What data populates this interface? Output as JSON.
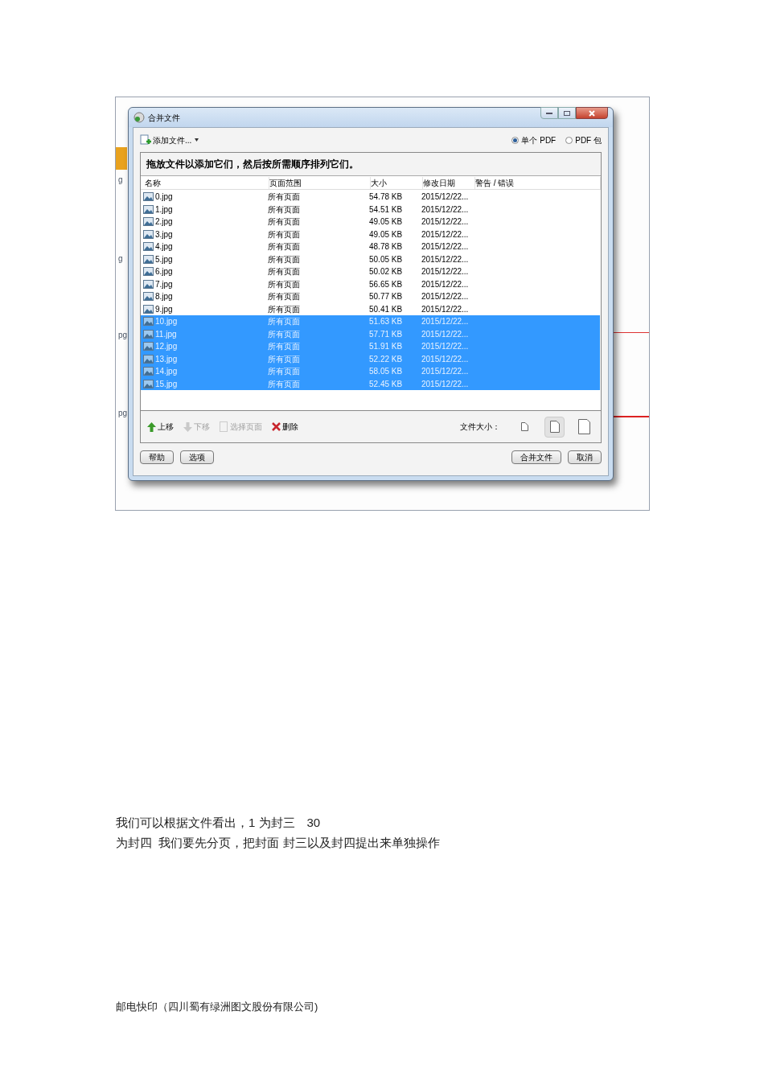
{
  "background_app": {
    "fragments": [
      "g",
      "g",
      "pg",
      "pg"
    ]
  },
  "dialog": {
    "title": "合并文件",
    "add_button": "添加文件...",
    "output_options": [
      {
        "label": "单个 PDF",
        "selected": true
      },
      {
        "label": "PDF 包",
        "selected": false
      }
    ],
    "instruction": "拖放文件以添加它们，然后按所需顺序排列它们。",
    "table": {
      "columns": [
        "名称",
        "页面范围",
        "大小",
        "修改日期",
        "警告 / 错误"
      ],
      "rows": [
        {
          "name": "0.jpg",
          "range": "所有页面",
          "size": "54.78 KB",
          "date": "2015/12/22...",
          "selected": false
        },
        {
          "name": "1.jpg",
          "range": "所有页面",
          "size": "54.51 KB",
          "date": "2015/12/22...",
          "selected": false
        },
        {
          "name": "2.jpg",
          "range": "所有页面",
          "size": "49.05 KB",
          "date": "2015/12/22...",
          "selected": false
        },
        {
          "name": "3.jpg",
          "range": "所有页面",
          "size": "49.05 KB",
          "date": "2015/12/22...",
          "selected": false
        },
        {
          "name": "4.jpg",
          "range": "所有页面",
          "size": "48.78 KB",
          "date": "2015/12/22...",
          "selected": false
        },
        {
          "name": "5.jpg",
          "range": "所有页面",
          "size": "50.05 KB",
          "date": "2015/12/22...",
          "selected": false
        },
        {
          "name": "6.jpg",
          "range": "所有页面",
          "size": "50.02 KB",
          "date": "2015/12/22...",
          "selected": false
        },
        {
          "name": "7.jpg",
          "range": "所有页面",
          "size": "56.65 KB",
          "date": "2015/12/22...",
          "selected": false
        },
        {
          "name": "8.jpg",
          "range": "所有页面",
          "size": "50.77 KB",
          "date": "2015/12/22...",
          "selected": false
        },
        {
          "name": "9.jpg",
          "range": "所有页面",
          "size": "50.41 KB",
          "date": "2015/12/22...",
          "selected": false
        },
        {
          "name": "10.jpg",
          "range": "所有页面",
          "size": "51.63 KB",
          "date": "2015/12/22...",
          "selected": true
        },
        {
          "name": "11.jpg",
          "range": "所有页面",
          "size": "57.71 KB",
          "date": "2015/12/22...",
          "selected": true
        },
        {
          "name": "12.jpg",
          "range": "所有页面",
          "size": "51.91 KB",
          "date": "2015/12/22...",
          "selected": true
        },
        {
          "name": "13.jpg",
          "range": "所有页面",
          "size": "52.22 KB",
          "date": "2015/12/22...",
          "selected": true
        },
        {
          "name": "14.jpg",
          "range": "所有页面",
          "size": "58.05 KB",
          "date": "2015/12/22...",
          "selected": true
        },
        {
          "name": "15.jpg",
          "range": "所有页面",
          "size": "52.45 KB",
          "date": "2015/12/22...",
          "selected": true
        }
      ]
    },
    "actions": [
      {
        "kind": "up",
        "label": "上移",
        "disabled": false
      },
      {
        "kind": "down",
        "label": "下移",
        "disabled": true
      },
      {
        "kind": "pages",
        "label": "选择页面",
        "disabled": true
      },
      {
        "kind": "delete",
        "label": "删除",
        "disabled": false
      }
    ],
    "file_size_label": "文件大小：",
    "file_sizes": [
      {
        "selected": false
      },
      {
        "selected": true
      },
      {
        "selected": false
      }
    ],
    "left_buttons": [
      "帮助",
      "选项"
    ],
    "right_buttons": [
      "合并文件",
      "取消"
    ]
  },
  "paragraph_lines": [
    "我们可以根据文件看出，1 为封三　30",
    "为封四  我们要先分页，把封面 封三以及封四提出来单独操作"
  ],
  "footer": "邮电快印（四川蜀有绿洲图文股份有限公司)"
}
